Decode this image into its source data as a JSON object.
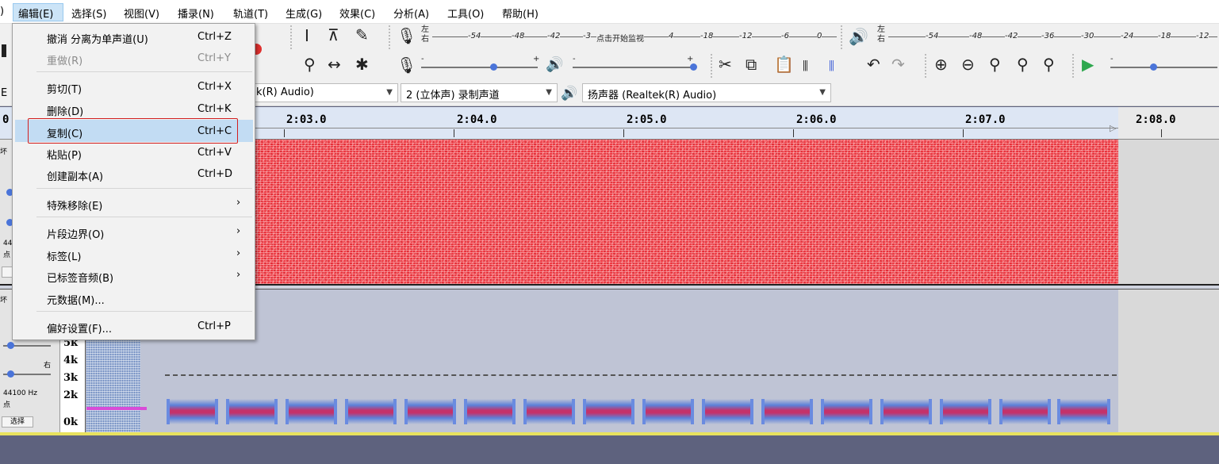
{
  "menubar": {
    "items": [
      ")",
      "编辑(E)",
      "选择(S)",
      "视图(V)",
      "播录(N)",
      "轨道(T)",
      "生成(G)",
      "效果(C)",
      "分析(A)",
      "工具(O)",
      "帮助(H)"
    ]
  },
  "toolbar": {
    "meter_left_ticks": [
      "-54",
      "-48",
      "-42",
      "-3",
      "点击开始监视",
      "4",
      "-18",
      "-12",
      "-6",
      "0"
    ],
    "meter_right_ticks": [
      "-54",
      "-48",
      "-42",
      "-36",
      "-30",
      "-24",
      "-18",
      "-12"
    ],
    "lr_top": "左",
    "lr_bottom": "右",
    "minus": "-",
    "plus": "+"
  },
  "devices": {
    "left_stub": "E",
    "recording_device": "k(R) Audio)",
    "channels": "2 (立体声) 录制声道",
    "playback_device": "扬声器 (Realtek(R) Audio)"
  },
  "ruler": {
    "left_stub": "0",
    "labels": [
      "2:03.0",
      "2:04.0",
      "2:05.0",
      "2:06.0",
      "2:07.0",
      "2:08.0"
    ]
  },
  "track1": {
    "tab_text": "坏",
    "rate_text": "44",
    "rate_sub": "点",
    "select_button": "选"
  },
  "track2": {
    "tab_text": "坏",
    "rate_text": "44100 Hz",
    "rate_sub": "点",
    "pan_label": "右",
    "select_button": "选择"
  },
  "spectrogram": {
    "freq_labels": [
      "5k",
      "4k",
      "3k",
      "2k",
      "0k"
    ]
  },
  "edit_menu": {
    "items": [
      {
        "label": "撤消 分离为单声道(U)",
        "shortcut": "Ctrl+Z"
      },
      {
        "label": "重做(R)",
        "shortcut": "Ctrl+Y"
      },
      {
        "label": "剪切(T)",
        "shortcut": "Ctrl+X"
      },
      {
        "label": "删除(D)",
        "shortcut": "Ctrl+K"
      },
      {
        "label": "复制(C)",
        "shortcut": "Ctrl+C"
      },
      {
        "label": "粘贴(P)",
        "shortcut": "Ctrl+V"
      },
      {
        "label": "创建副本(A)",
        "shortcut": "Ctrl+D"
      },
      {
        "label": "特殊移除(E)",
        "arrow": "›"
      },
      {
        "label": "片段边界(O)",
        "arrow": "›"
      },
      {
        "label": "标签(L)",
        "arrow": "›"
      },
      {
        "label": "已标签音频(B)",
        "arrow": "›"
      },
      {
        "label": "元数据(M)..."
      },
      {
        "label": "偏好设置(F)...",
        "shortcut": "Ctrl+P"
      }
    ]
  },
  "colors": {
    "waveform": "#ef3b44",
    "highlight": "#c2dcf3",
    "annotation_box": "#d21f1f",
    "background": "#5e627e"
  }
}
